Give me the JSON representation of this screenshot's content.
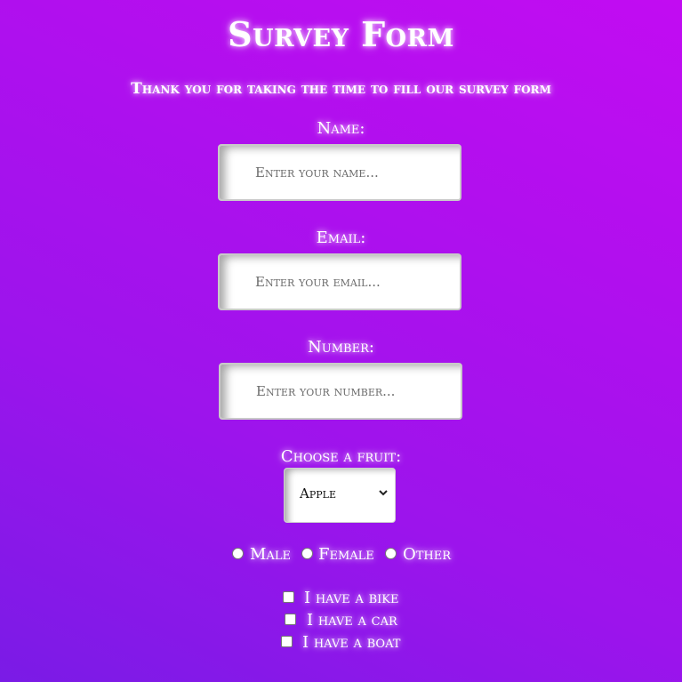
{
  "form": {
    "title": "Survey Form",
    "subtitle": "Thank you for taking the time to fill our survey form",
    "name": {
      "label": "Name:",
      "placeholder": "Enter your name..."
    },
    "email": {
      "label": "Email:",
      "placeholder": "Enter your email..."
    },
    "number": {
      "label": "Number:",
      "placeholder": "Enter your number..."
    },
    "fruit": {
      "label": "Choose a fruit:",
      "selected": "Apple",
      "icon": "chevron-down-icon"
    },
    "gender_options": [
      "Male",
      "Female",
      "Other"
    ],
    "vehicle_options": [
      "I have a bike",
      "I have a car",
      "I have a boat"
    ]
  },
  "colors": {
    "background_start": "#7a1be6",
    "background_end": "#c20cf2",
    "text": "#ffffff"
  }
}
